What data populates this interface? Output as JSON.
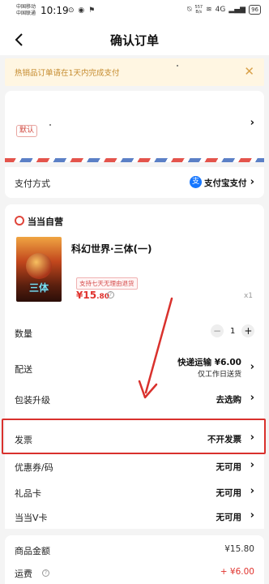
{
  "status_bar": {
    "carrier_1": "中国移动",
    "carrier_2": "中国联通",
    "time": "10:19",
    "speed": "557",
    "speed_unit": "B/s",
    "network": "4G",
    "battery": "96"
  },
  "nav": {
    "title": "确认订单",
    "back_icon": "chevron-left-icon"
  },
  "notice": {
    "text": "热销品订单请在1天内完成支付",
    "close_icon": "close-icon"
  },
  "address": {
    "default_tag": "默认"
  },
  "payment": {
    "label": "支付方式",
    "method_icon_text": "支",
    "value": "支付宝支付"
  },
  "store": {
    "name": "当当自营"
  },
  "product": {
    "title": "科幻世界·三体(一)",
    "cover_title": "三体",
    "tag": "支持七天无理由退货",
    "price_symbol": "¥",
    "price_int": "15",
    "price_dec": ".80",
    "quantity_label": "x1"
  },
  "rows": {
    "quantity": {
      "label": "数量",
      "minus": "−",
      "value": "1",
      "plus": "+"
    },
    "shipping": {
      "label": "配送",
      "value": "快递运输 ¥6.00",
      "sub": "仅工作日送货"
    },
    "wrapping": {
      "label": "包装升级",
      "value": "去选购"
    },
    "invoice": {
      "label": "发票",
      "value": "不开发票"
    },
    "coupon": {
      "label": "优惠券/码",
      "value": "无可用"
    },
    "gift_card": {
      "label": "礼品卡",
      "value": "无可用"
    },
    "v_card": {
      "label": "当当V卡",
      "value": "无可用"
    }
  },
  "summary": {
    "goods_label": "商品金额",
    "goods_value": "¥15.80",
    "freight_label": "运费",
    "freight_value": "+ ¥6.00"
  },
  "colors": {
    "accent": "#e0322d",
    "annotation": "#d9312d",
    "alipay": "#1677ff"
  }
}
